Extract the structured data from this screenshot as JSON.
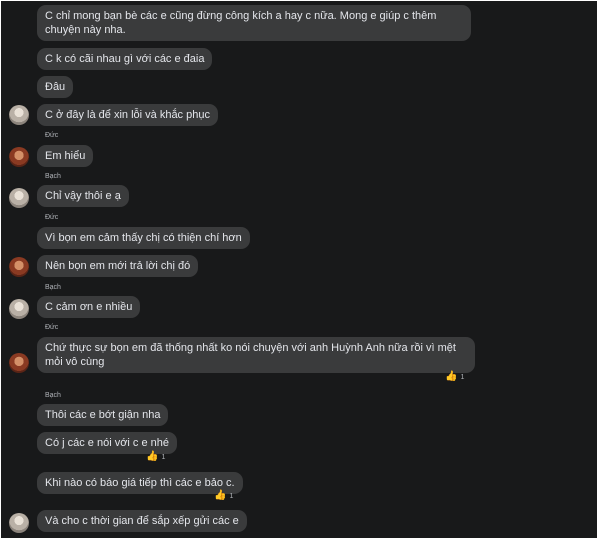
{
  "messages": [
    {
      "text": "C chỉ mong bạn bè các e cũng đừng công kích a hay c nữa. Mong e giúp c thêm chuyện này nha."
    },
    {
      "text": "C k có cãi nhau gì với các e đaia"
    },
    {
      "text": "Đâu"
    },
    {
      "text": "C ở đây là để xin lỗi và khắc phục"
    },
    {
      "sender": "Đức",
      "text": "Em hiểu"
    },
    {
      "sender": "Bạch",
      "text": "Chỉ vậy thôi e ạ"
    },
    {
      "sender": "Đức",
      "text": "Vì bọn em cảm thấy chị có thiện chí hơn"
    },
    {
      "text": "Nên bọn em mới trả lời chị đó"
    },
    {
      "sender": "Bạch",
      "text": "C cảm ơn e nhiều"
    },
    {
      "sender": "Đức",
      "text": "Chứ thực sự bọn em đã thống nhất ko nói chuyện với anh Huỳnh Anh nữa rồi vì mệt mỏi vô cùng",
      "reaction": {
        "icon": "thumbs-up-icon",
        "count": "1"
      }
    },
    {
      "sender": "Bạch",
      "text": "Thôi các e bớt giận nha"
    },
    {
      "text": "Có j các e nói với c e nhé",
      "reaction": {
        "icon": "thumbs-up-icon",
        "count": "1"
      }
    },
    {
      "text": "Khi nào có báo giá tiếp thì các e bảo c.",
      "reaction": {
        "icon": "thumbs-up-icon",
        "count": "1"
      }
    },
    {
      "text": "Và cho c thời gian để sắp xếp gửi các e"
    }
  ],
  "colors": {
    "background": "#18191a",
    "bubble": "#3a3b3c",
    "text": "#e4e6eb",
    "meta": "#b0b3b8",
    "like": "#f0c24b"
  }
}
